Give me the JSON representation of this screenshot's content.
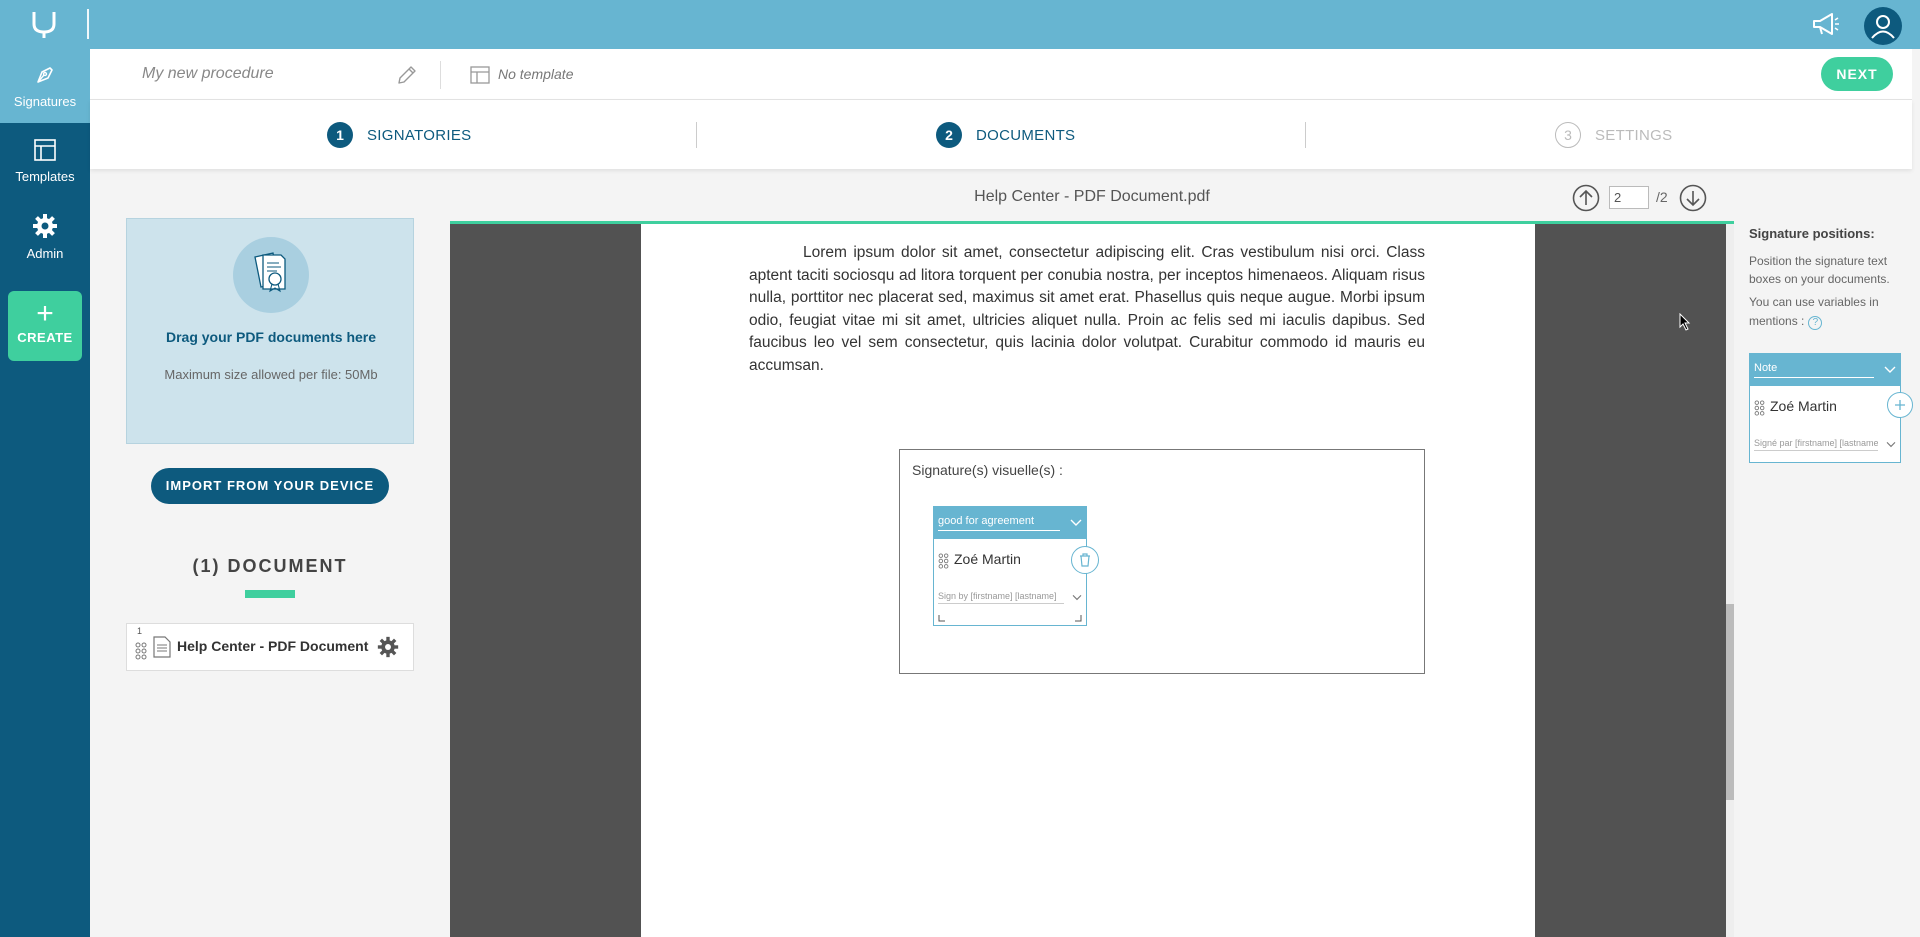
{
  "sidebar": {
    "items": [
      {
        "label": "Signatures",
        "icon": "pen-nib-icon"
      },
      {
        "label": "Templates",
        "icon": "layout-icon"
      },
      {
        "label": "Admin",
        "icon": "gear-icon"
      }
    ],
    "create_label": "CREATE",
    "create_icon": "plus-icon"
  },
  "header": {
    "procedure_name": "My new procedure",
    "template_label": "No template",
    "next_label": "NEXT"
  },
  "steps": [
    {
      "number": "1",
      "label": "SIGNATORIES"
    },
    {
      "number": "2",
      "label": "DOCUMENTS"
    },
    {
      "number": "3",
      "label": "SETTINGS"
    }
  ],
  "dropzone": {
    "title": "Drag your PDF documents here",
    "subtitle": "Maximum size allowed per file: 50Mb"
  },
  "import_label": "IMPORT FROM YOUR DEVICE",
  "documents": {
    "count_label": "(1) DOCUMENT",
    "items": [
      {
        "index": "1",
        "name": "Help Center - PDF Document"
      }
    ]
  },
  "viewer": {
    "file_name": "Help Center - PDF Document.pdf",
    "current_page": "2",
    "total_pages": "/2",
    "page_text": "Lorem ipsum dolor sit amet, consectetur adipiscing elit. Cras vestibulum nisi orci. Class aptent taciti sociosqu ad litora torquent per conubia nostra, per inceptos himenaeos. Aliquam risus nulla, porttitor nec placerat sed, maximus sit amet erat. Phasellus quis neque augue. Morbi ipsum odio, feugiat vitae mi sit amet, ultricies aliquet nulla. Proin ac felis sed mi iaculis dapibus. Sed faucibus leo vel sem consectetur, quis lacinia dolor volutpat. Curabitur commodo id mauris eu accumsan.",
    "signature_frame_title": "Signature(s) visuelle(s) :",
    "placed_signature": {
      "mention_type": "good for agreement",
      "name": "Zoé Martin",
      "mention_text": "Sign by [firstname] [lastname]"
    }
  },
  "right_panel": {
    "title": "Signature positions:",
    "description": "Position the signature text boxes on your documents.",
    "variables_text": "You can use variables in mentions :",
    "help_label": "?",
    "template_signature": {
      "mention_type": "Note",
      "name": "Zoé Martin",
      "mention_text": "Signé par [firstname] [lastname]"
    }
  },
  "colors": {
    "primary": "#0d5a7e",
    "accent": "#67b5d1",
    "success": "#3fcf9e"
  }
}
